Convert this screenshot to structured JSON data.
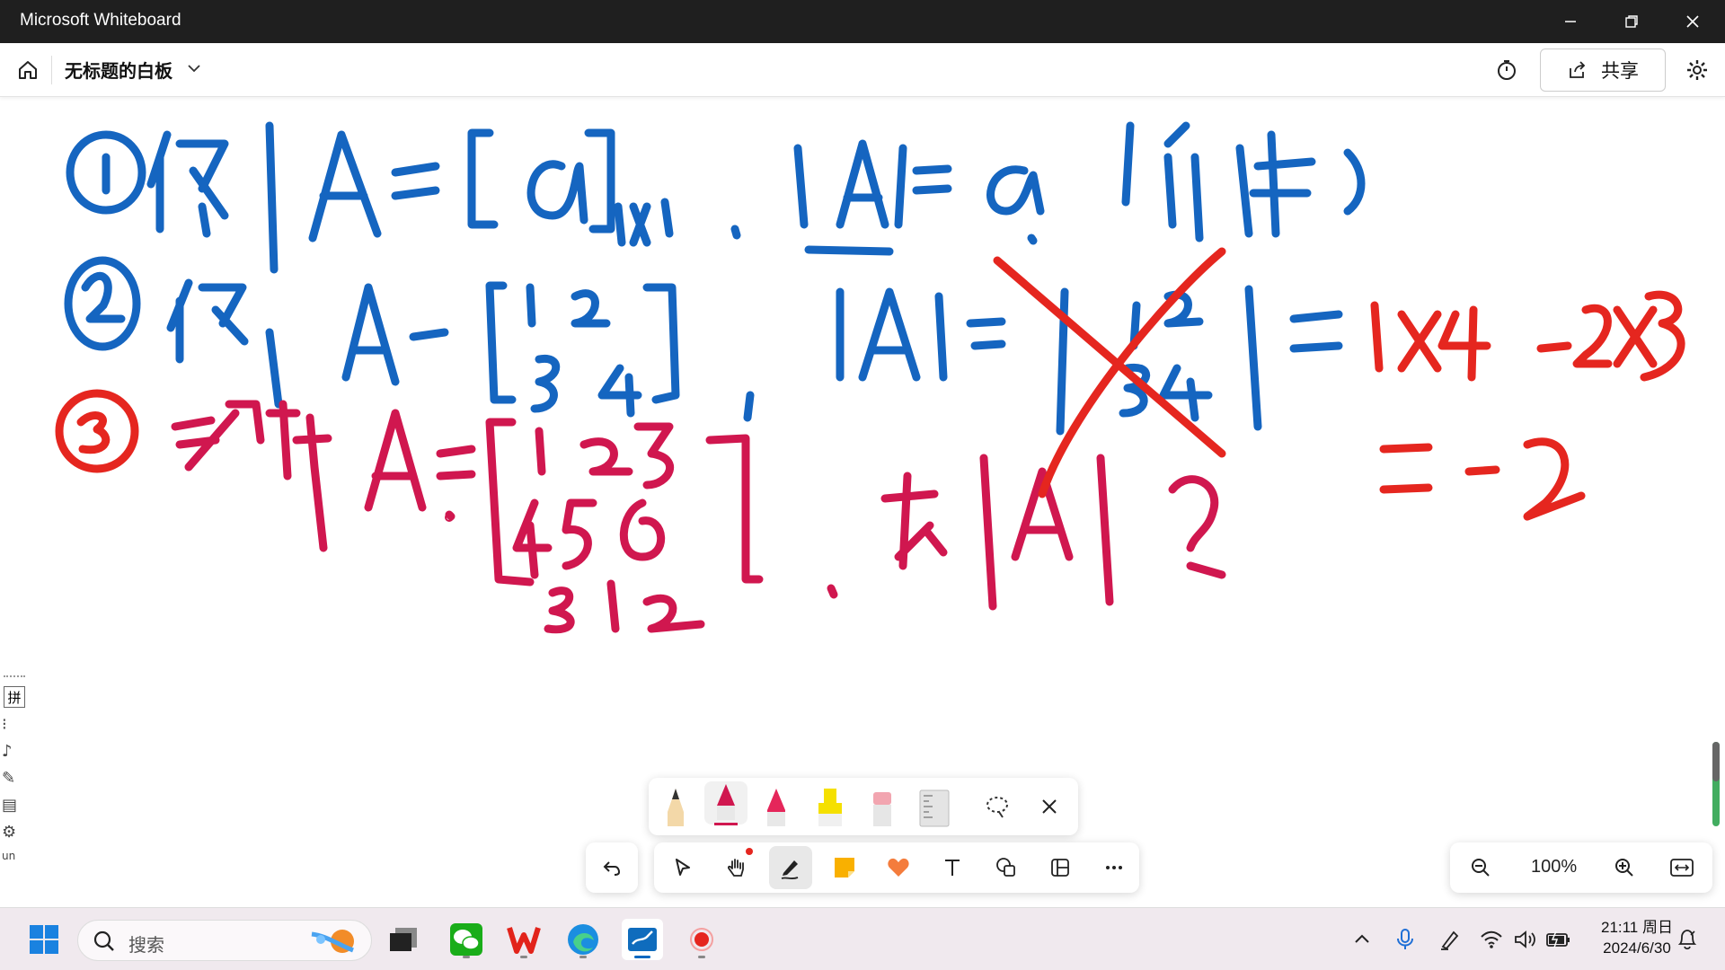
{
  "window": {
    "title": "Microsoft Whiteboard"
  },
  "appbar": {
    "board_title": "无标题的白板",
    "share_label": "共享"
  },
  "ink_toolbar": {
    "tools": [
      "pencil-tool",
      "pen-tool-crimson",
      "pen-tool-red",
      "highlighter-tool",
      "eraser-tool",
      "ruler-tool",
      "lasso-tool"
    ]
  },
  "main_toolbar": {
    "tools": [
      "select-tool",
      "hand-tool",
      "pen-tool",
      "sticky-note-tool",
      "reaction-tool",
      "text-tool",
      "shapes-tool",
      "templates-tool",
      "more-tool"
    ]
  },
  "zoom": {
    "level": "100%"
  },
  "ime_bar": {
    "mode_label": "拼"
  },
  "taskbar": {
    "search_placeholder": "搜索",
    "time": "21:11 周日",
    "date": "2024/6/30"
  },
  "colors": {
    "ink_blue": "#1565c0",
    "ink_crimson": "#d0174f",
    "ink_red": "#e5261f",
    "accent": "#0067c0"
  }
}
